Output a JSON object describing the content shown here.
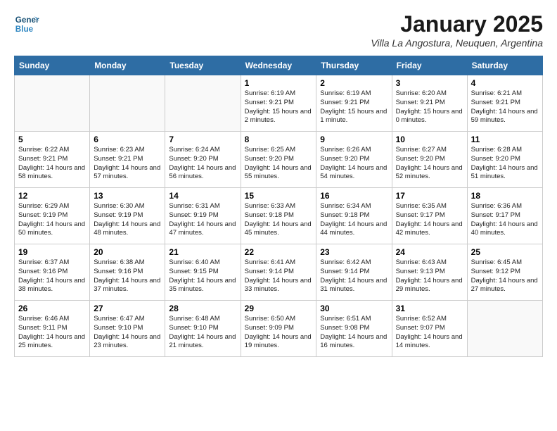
{
  "logo": {
    "line1": "General",
    "line2": "Blue"
  },
  "title": "January 2025",
  "subtitle": "Villa La Angostura, Neuquen, Argentina",
  "days_of_week": [
    "Sunday",
    "Monday",
    "Tuesday",
    "Wednesday",
    "Thursday",
    "Friday",
    "Saturday"
  ],
  "weeks": [
    [
      {
        "day": "",
        "info": ""
      },
      {
        "day": "",
        "info": ""
      },
      {
        "day": "",
        "info": ""
      },
      {
        "day": "1",
        "info": "Sunrise: 6:19 AM\nSunset: 9:21 PM\nDaylight: 15 hours\nand 2 minutes."
      },
      {
        "day": "2",
        "info": "Sunrise: 6:19 AM\nSunset: 9:21 PM\nDaylight: 15 hours\nand 1 minute."
      },
      {
        "day": "3",
        "info": "Sunrise: 6:20 AM\nSunset: 9:21 PM\nDaylight: 15 hours\nand 0 minutes."
      },
      {
        "day": "4",
        "info": "Sunrise: 6:21 AM\nSunset: 9:21 PM\nDaylight: 14 hours\nand 59 minutes."
      }
    ],
    [
      {
        "day": "5",
        "info": "Sunrise: 6:22 AM\nSunset: 9:21 PM\nDaylight: 14 hours\nand 58 minutes."
      },
      {
        "day": "6",
        "info": "Sunrise: 6:23 AM\nSunset: 9:21 PM\nDaylight: 14 hours\nand 57 minutes."
      },
      {
        "day": "7",
        "info": "Sunrise: 6:24 AM\nSunset: 9:20 PM\nDaylight: 14 hours\nand 56 minutes."
      },
      {
        "day": "8",
        "info": "Sunrise: 6:25 AM\nSunset: 9:20 PM\nDaylight: 14 hours\nand 55 minutes."
      },
      {
        "day": "9",
        "info": "Sunrise: 6:26 AM\nSunset: 9:20 PM\nDaylight: 14 hours\nand 54 minutes."
      },
      {
        "day": "10",
        "info": "Sunrise: 6:27 AM\nSunset: 9:20 PM\nDaylight: 14 hours\nand 52 minutes."
      },
      {
        "day": "11",
        "info": "Sunrise: 6:28 AM\nSunset: 9:20 PM\nDaylight: 14 hours\nand 51 minutes."
      }
    ],
    [
      {
        "day": "12",
        "info": "Sunrise: 6:29 AM\nSunset: 9:19 PM\nDaylight: 14 hours\nand 50 minutes."
      },
      {
        "day": "13",
        "info": "Sunrise: 6:30 AM\nSunset: 9:19 PM\nDaylight: 14 hours\nand 48 minutes."
      },
      {
        "day": "14",
        "info": "Sunrise: 6:31 AM\nSunset: 9:19 PM\nDaylight: 14 hours\nand 47 minutes."
      },
      {
        "day": "15",
        "info": "Sunrise: 6:33 AM\nSunset: 9:18 PM\nDaylight: 14 hours\nand 45 minutes."
      },
      {
        "day": "16",
        "info": "Sunrise: 6:34 AM\nSunset: 9:18 PM\nDaylight: 14 hours\nand 44 minutes."
      },
      {
        "day": "17",
        "info": "Sunrise: 6:35 AM\nSunset: 9:17 PM\nDaylight: 14 hours\nand 42 minutes."
      },
      {
        "day": "18",
        "info": "Sunrise: 6:36 AM\nSunset: 9:17 PM\nDaylight: 14 hours\nand 40 minutes."
      }
    ],
    [
      {
        "day": "19",
        "info": "Sunrise: 6:37 AM\nSunset: 9:16 PM\nDaylight: 14 hours\nand 38 minutes."
      },
      {
        "day": "20",
        "info": "Sunrise: 6:38 AM\nSunset: 9:16 PM\nDaylight: 14 hours\nand 37 minutes."
      },
      {
        "day": "21",
        "info": "Sunrise: 6:40 AM\nSunset: 9:15 PM\nDaylight: 14 hours\nand 35 minutes."
      },
      {
        "day": "22",
        "info": "Sunrise: 6:41 AM\nSunset: 9:14 PM\nDaylight: 14 hours\nand 33 minutes."
      },
      {
        "day": "23",
        "info": "Sunrise: 6:42 AM\nSunset: 9:14 PM\nDaylight: 14 hours\nand 31 minutes."
      },
      {
        "day": "24",
        "info": "Sunrise: 6:43 AM\nSunset: 9:13 PM\nDaylight: 14 hours\nand 29 minutes."
      },
      {
        "day": "25",
        "info": "Sunrise: 6:45 AM\nSunset: 9:12 PM\nDaylight: 14 hours\nand 27 minutes."
      }
    ],
    [
      {
        "day": "26",
        "info": "Sunrise: 6:46 AM\nSunset: 9:11 PM\nDaylight: 14 hours\nand 25 minutes."
      },
      {
        "day": "27",
        "info": "Sunrise: 6:47 AM\nSunset: 9:10 PM\nDaylight: 14 hours\nand 23 minutes."
      },
      {
        "day": "28",
        "info": "Sunrise: 6:48 AM\nSunset: 9:10 PM\nDaylight: 14 hours\nand 21 minutes."
      },
      {
        "day": "29",
        "info": "Sunrise: 6:50 AM\nSunset: 9:09 PM\nDaylight: 14 hours\nand 19 minutes."
      },
      {
        "day": "30",
        "info": "Sunrise: 6:51 AM\nSunset: 9:08 PM\nDaylight: 14 hours\nand 16 minutes."
      },
      {
        "day": "31",
        "info": "Sunrise: 6:52 AM\nSunset: 9:07 PM\nDaylight: 14 hours\nand 14 minutes."
      },
      {
        "day": "",
        "info": ""
      }
    ]
  ]
}
